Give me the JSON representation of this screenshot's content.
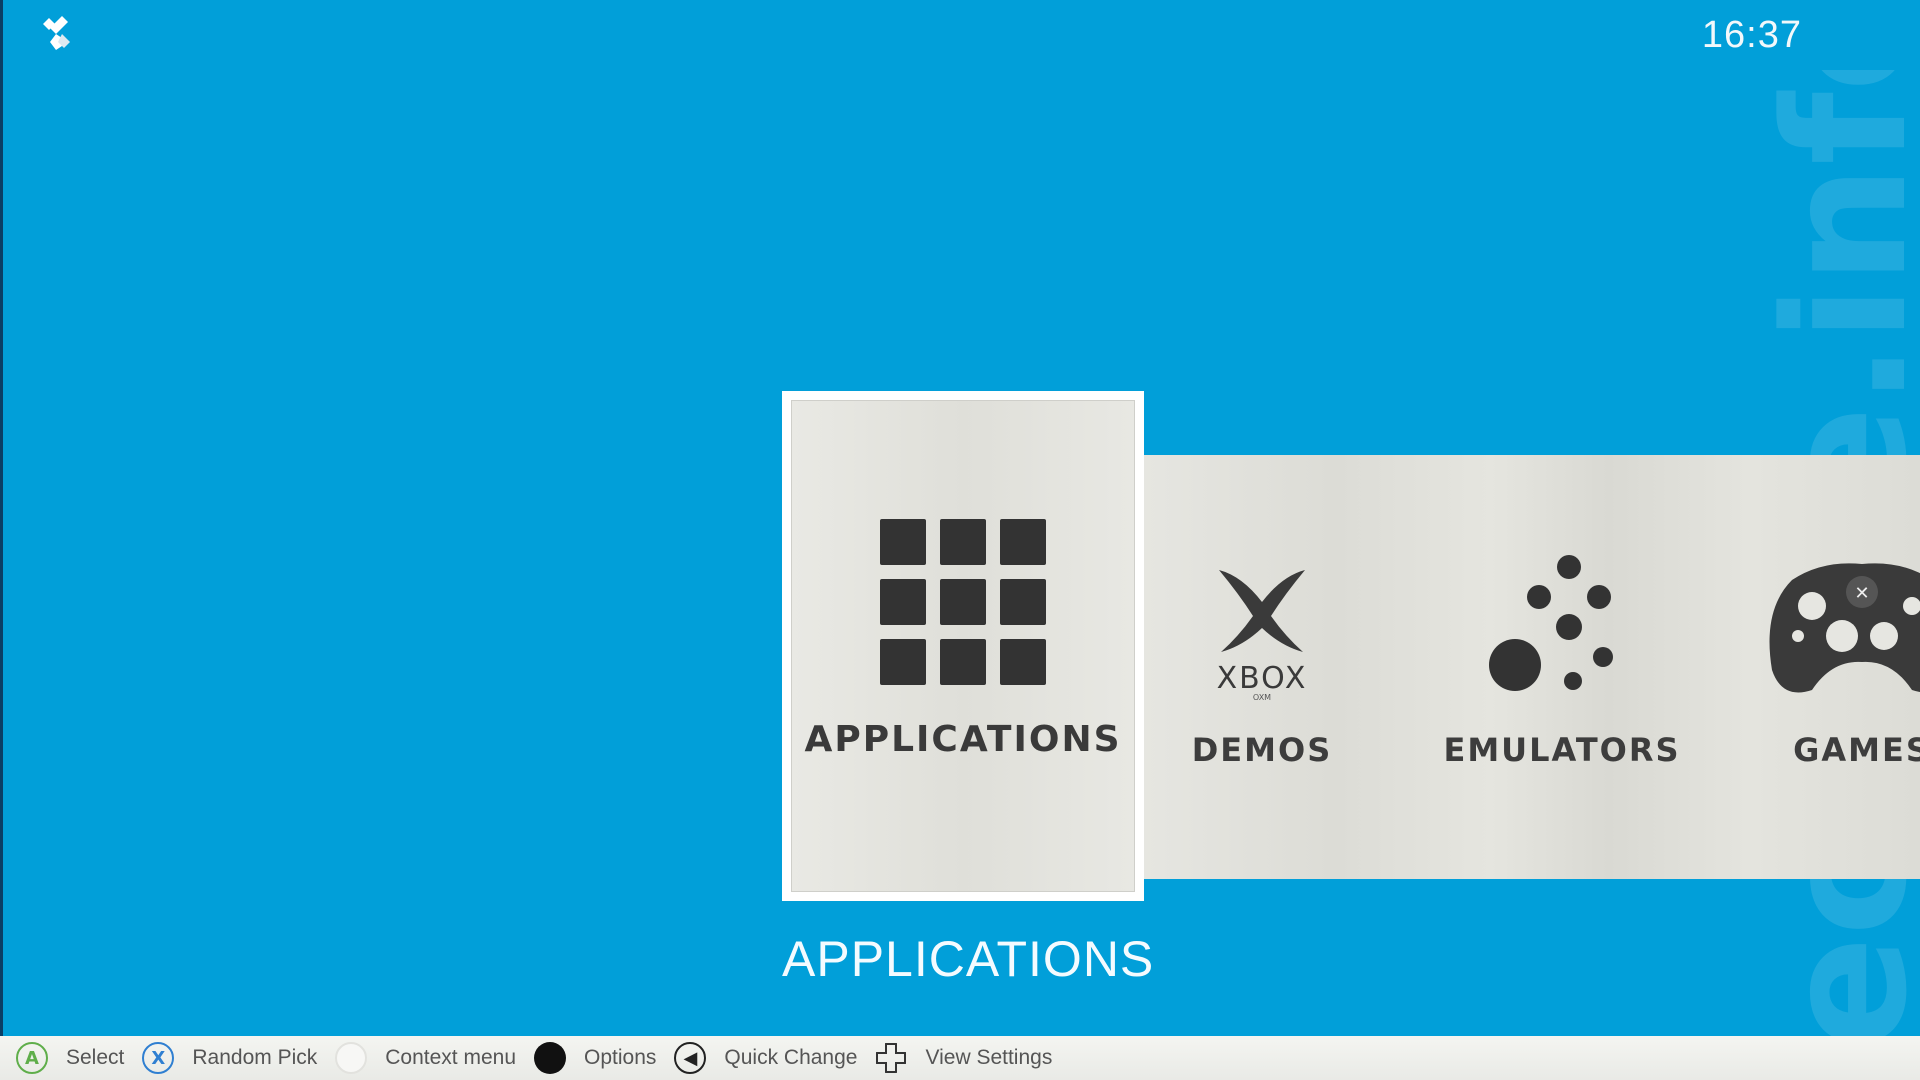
{
  "status_bar": {
    "clock": "16:37",
    "logo_icon": "kodi-diamond-icon"
  },
  "watermark": {
    "text": "ecrape.info"
  },
  "carousel": {
    "selected_index": 0,
    "items": [
      {
        "label": "APPLICATIONS",
        "icon": "app-grid-icon"
      },
      {
        "label": "DEMOS",
        "icon": "xbox-logo-icon"
      },
      {
        "label": "EMULATORS",
        "icon": "dots-icon"
      },
      {
        "label": "GAMES",
        "icon": "gamepad-icon"
      }
    ]
  },
  "selected_title": "APPLICATIONS",
  "footer": {
    "hints": [
      {
        "glyph": "A",
        "label": "Select",
        "icon": "a-button-icon"
      },
      {
        "glyph": "X",
        "label": "Random Pick",
        "icon": "x-button-icon"
      },
      {
        "glyph": "",
        "label": "Context menu",
        "icon": "white-button-icon"
      },
      {
        "glyph": "",
        "label": "Options",
        "icon": "black-button-icon"
      },
      {
        "glyph": "◀",
        "label": "Quick Change",
        "icon": "back-button-icon"
      },
      {
        "glyph": "",
        "label": "View Settings",
        "icon": "dpad-icon"
      }
    ]
  },
  "colors": {
    "background": "#019fd9",
    "tile": "#e3e3de",
    "tile_text": "#3d3d3d",
    "footer": "#f0f1ed",
    "a_button": "#5fae4a",
    "x_button": "#2f7fd1"
  }
}
